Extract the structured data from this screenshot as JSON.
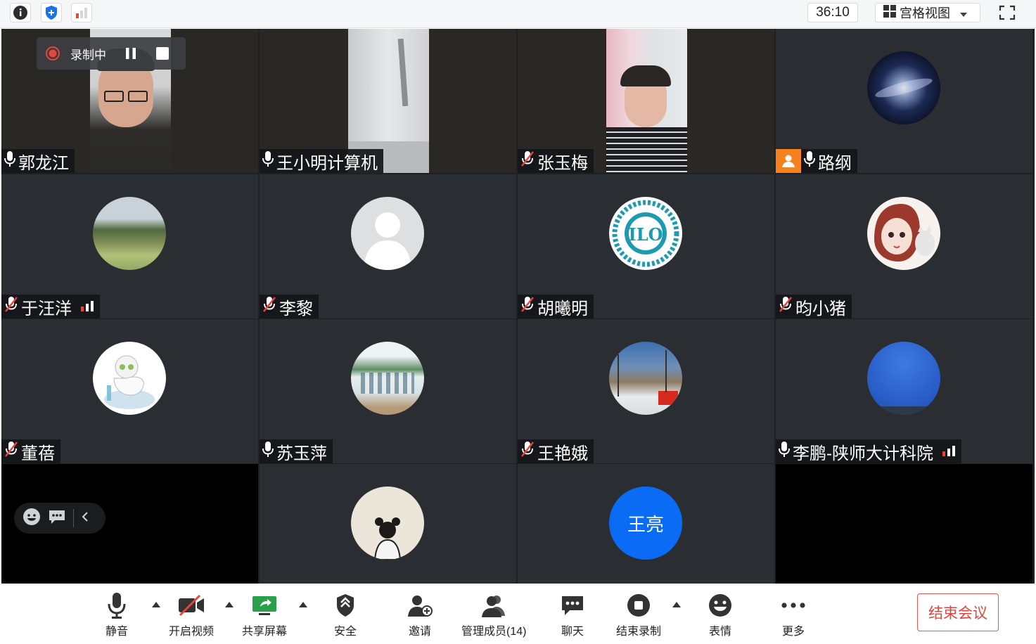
{
  "topbar": {
    "timer": "36:10",
    "view_mode": "宫格视图"
  },
  "recording": {
    "label": "录制中"
  },
  "participants": [
    {
      "name": "郭龙江",
      "mic": "on"
    },
    {
      "name": "王小明计算机",
      "mic": "on"
    },
    {
      "name": "张玉梅",
      "mic": "muted"
    },
    {
      "name": "路纲",
      "mic": "on",
      "host": true
    },
    {
      "name": "于汪洋",
      "mic": "muted",
      "signal": true
    },
    {
      "name": "李黎",
      "mic": "muted"
    },
    {
      "name": "胡曦明",
      "mic": "muted"
    },
    {
      "name": "昀小猪",
      "mic": "muted"
    },
    {
      "name": "董蓓",
      "mic": "muted"
    },
    {
      "name": "苏玉萍",
      "mic": "on"
    },
    {
      "name": "王艳娥",
      "mic": "muted"
    },
    {
      "name": "李鹏-陕师大计科院",
      "mic": "on",
      "signal": true
    },
    {
      "name": "",
      "mic": ""
    },
    {
      "name": "",
      "mic": ""
    },
    {
      "name": "",
      "mic": "",
      "avatar_text": "王亮"
    }
  ],
  "toolbar": {
    "mute": "静音",
    "video": "开启视频",
    "share": "共享屏幕",
    "security": "安全",
    "invite": "邀请",
    "members": "管理成员(14)",
    "chat": "聊天",
    "stop_record": "结束录制",
    "reactions": "表情",
    "more": "更多",
    "end_meeting": "结束会议"
  },
  "colors": {
    "accent_blue": "#0a6cf5",
    "end_red": "#e0453b",
    "tile_bg": "#2a2d31",
    "host_badge": "#f5821f"
  }
}
